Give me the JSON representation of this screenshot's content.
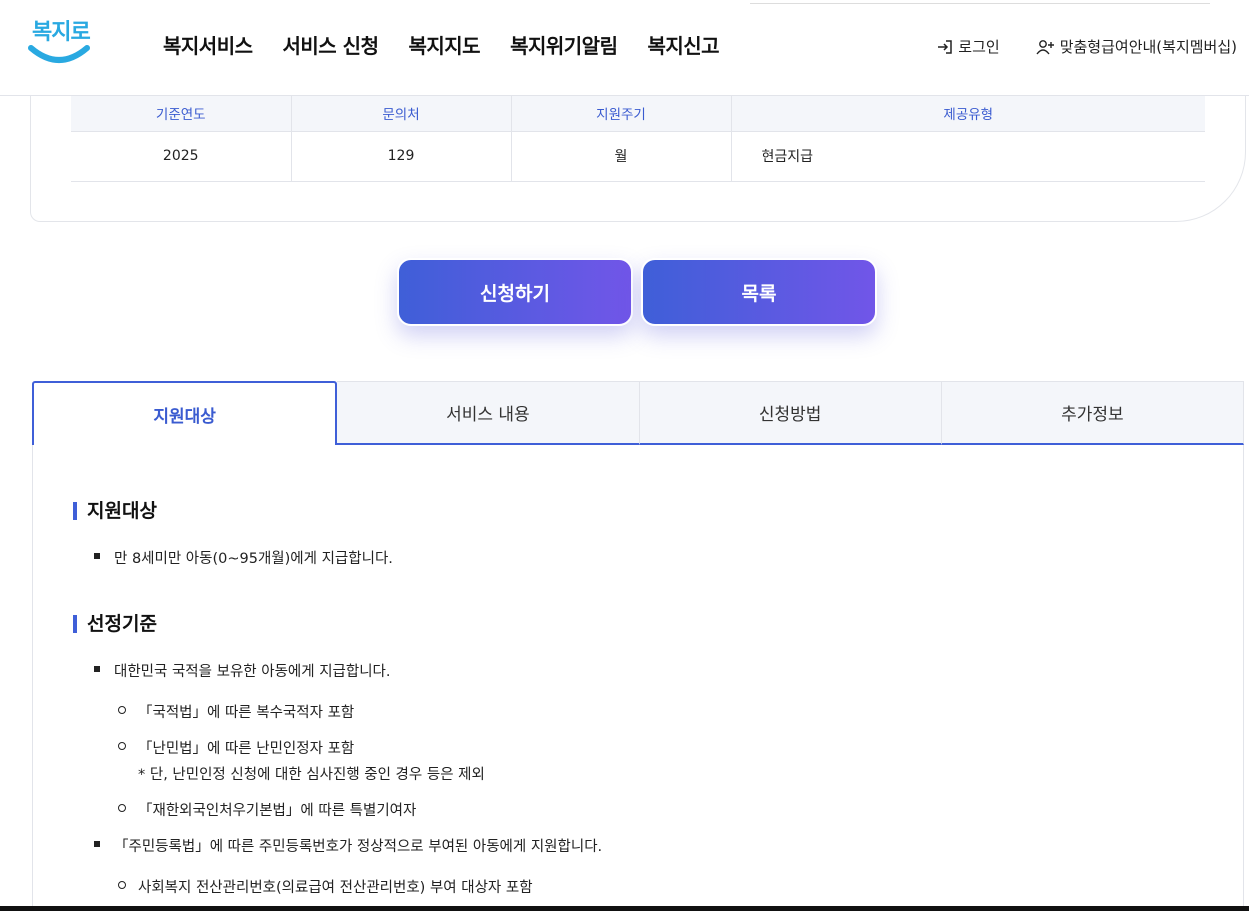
{
  "header": {
    "logo_text": "복지로",
    "nav": [
      "복지서비스",
      "서비스 신청",
      "복지지도",
      "복지위기알림",
      "복지신고"
    ],
    "login": "로그인",
    "membership": "맞춤형급여안내(복지멤버십)"
  },
  "info_table": {
    "headers": [
      "기준연도",
      "문의처",
      "지원주기",
      "제공유형"
    ],
    "row": [
      "2025",
      "129",
      "월",
      "현금지급"
    ]
  },
  "buttons": {
    "apply": "신청하기",
    "list": "목록"
  },
  "tabs": [
    "지원대상",
    "서비스 내용",
    "신청방법",
    "추가정보"
  ],
  "content": {
    "section1_title": "지원대상",
    "section1_bullet": "만 8세미만 아동(0~95개월)에게 지급합니다.",
    "section2_title": "선정기준",
    "bullet1": "대한민국 국적을 보유한 아동에게 지급합니다.",
    "sub1": "「국적법」에 따른 복수국적자 포함",
    "sub2": "「난민법」에 따른 난민인정자 포함",
    "note2": "* 단, 난민인정 신청에 대한 심사진행 중인 경우 등은 제외",
    "sub3": "「재한외국인처우기본법」에 따른 특별기여자",
    "bullet2": "「주민등록법」에 따른 주민등록번호가 정상적으로 부여된 아동에게 지원합니다.",
    "sub4": "사회복지 전산관리번호(의료급여 전산관리번호) 부여 대상자 포함"
  },
  "colors": {
    "accent": "#3f5fd8",
    "gradient_end": "#7156e8",
    "logo": "#29a9e1"
  }
}
